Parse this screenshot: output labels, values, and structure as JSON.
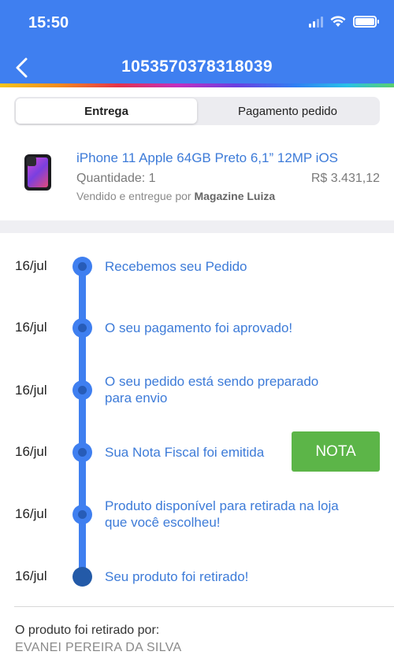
{
  "status_bar": {
    "time": "15:50"
  },
  "header": {
    "title": "1053570378318039"
  },
  "tabs": [
    {
      "label": "Entrega",
      "active": true
    },
    {
      "label": "Pagamento pedido",
      "active": false
    }
  ],
  "product": {
    "name": "iPhone 11 Apple 64GB Preto 6,1” 12MP iOS",
    "quantity": "Quantidade: 1",
    "price": "R$ 3.431,12",
    "seller_prefix": "Vendido e entregue por",
    "seller_name": "Magazine Luiza"
  },
  "timeline": [
    {
      "date": "16/jul",
      "text": "Recebemos seu Pedido"
    },
    {
      "date": "16/jul",
      "text": "O seu pagamento foi aprovado!"
    },
    {
      "date": "16/jul",
      "text": "O seu pedido está sendo preparado para envio"
    },
    {
      "date": "16/jul",
      "text": "Sua Nota Fiscal foi emitida"
    },
    {
      "date": "16/jul",
      "text": "Produto disponível para retirada na loja que você escolheu!"
    },
    {
      "date": "16/jul",
      "text": "Seu produto foi retirado!"
    }
  ],
  "nota_button": {
    "label": "NOTA"
  },
  "pickup": {
    "label": "O produto foi retirado por:",
    "name": "EVANEI PEREIRA DA SILVA"
  },
  "colors": {
    "header": "#3f7ff0",
    "link_blue": "#3d7bd8",
    "nota_green": "#5cb548"
  }
}
